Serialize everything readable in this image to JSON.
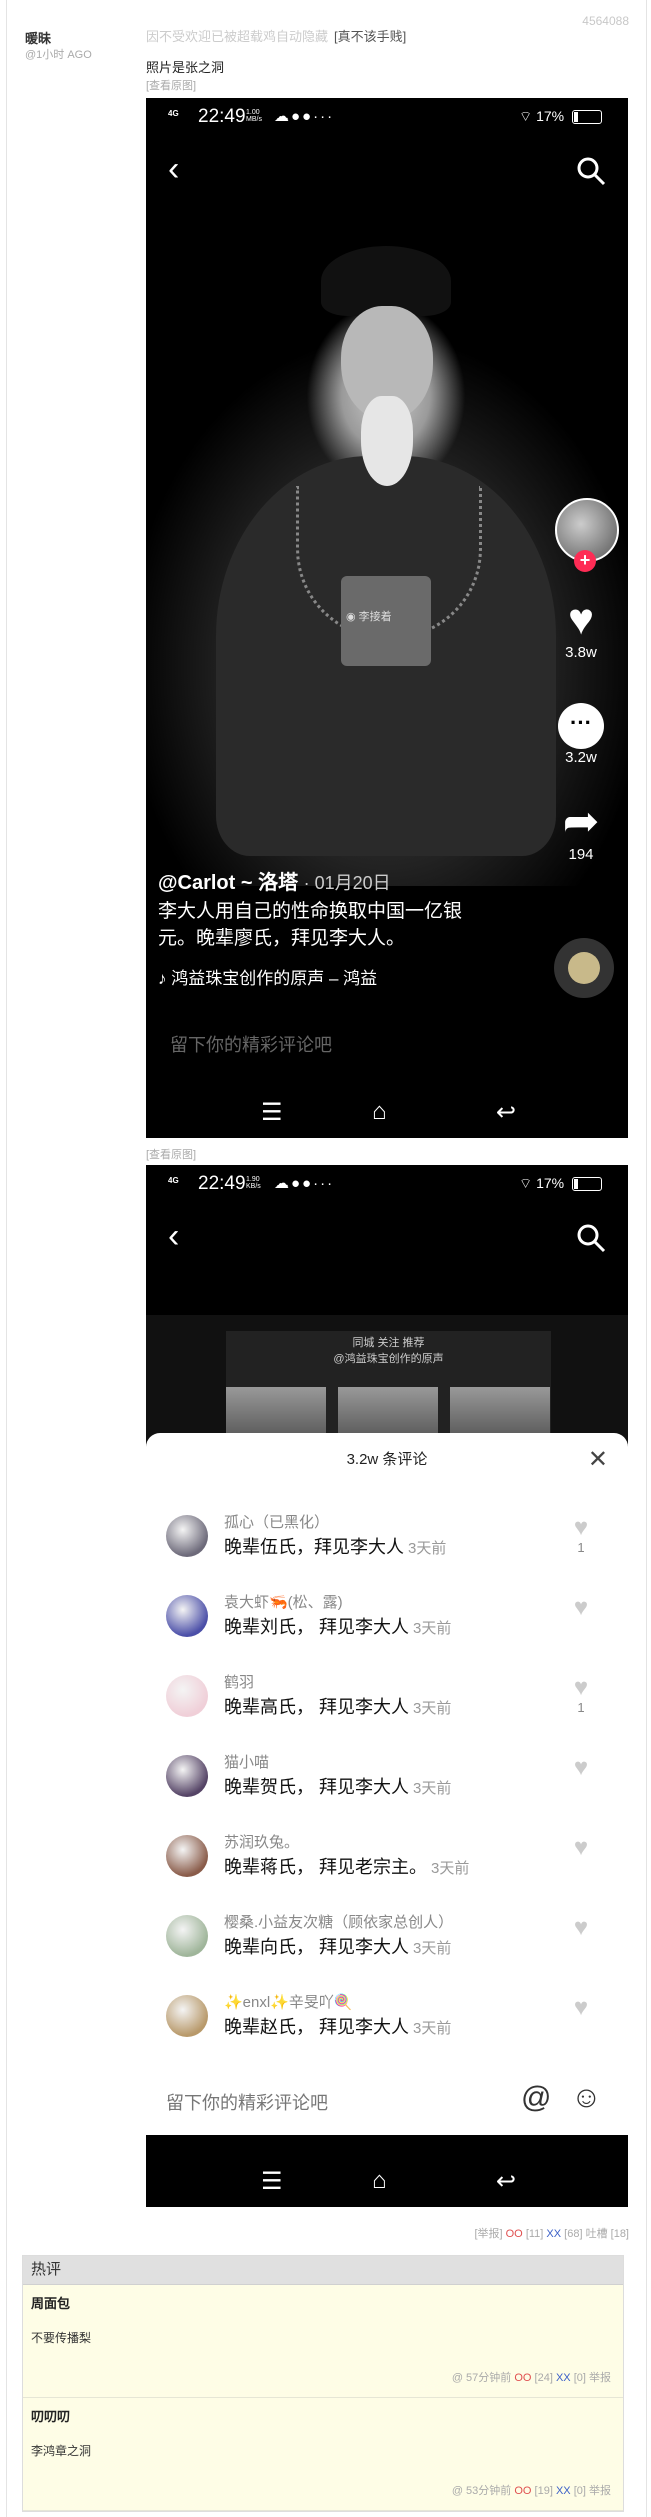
{
  "post": {
    "id": "4564088",
    "author": "暖昧",
    "time": "@1小时 AGO",
    "notice": "因不受欢迎已被超载鸡自动隐藏",
    "notice_tag": "[真不该手贱]",
    "text": "照片是张之洞",
    "view_original_1": "[查看原图]",
    "view_original_2": "[查看原图]"
  },
  "shot1": {
    "status": {
      "signal": "4G",
      "time": "22:49",
      "speed": "1.00",
      "speed_unit": "MB/s",
      "battery": "17%"
    },
    "likes": "3.8w",
    "comments": "3.2w",
    "shares": "194",
    "watermark": "李接着",
    "handle": "@Carlot ~ 洛塔",
    "date": "01月20日",
    "caption": "李大人用自己的性命换取中国一亿银元。晚辈廖氏，拜见李大人。",
    "music": "鸿益珠宝创作的原声 – 鸿益",
    "comment_placeholder": "留下你的精彩评论吧"
  },
  "shot2": {
    "status": {
      "signal": "4G",
      "time": "22:49",
      "speed": "1.90",
      "speed_unit": "KB/s",
      "battery": "17%"
    },
    "inner_tabs": "同城  关注  推荐",
    "inner_title": "@鸿益珠宝创作的原声",
    "sheet_title": "3.2w 条评论",
    "comments": [
      {
        "user": "孤心（已黑化）",
        "text": "晚辈伍氏，拜见李大人",
        "ago": "3天前",
        "likes": "1",
        "color": "#6d6a7a"
      },
      {
        "user": "袁大虾🦐(松、露)",
        "text": "晚辈刘氏，  拜见李大人",
        "ago": "3天前",
        "likes": "",
        "color": "#4b4fa8"
      },
      {
        "user": "鹤羽",
        "text": "晚辈高氏，  拜见李大人",
        "ago": "3天前",
        "likes": "1",
        "color": "#f0cfd8"
      },
      {
        "user": "猫小喵",
        "text": "晚辈贺氏，  拜见李大人",
        "ago": "3天前",
        "likes": "",
        "color": "#554466"
      },
      {
        "user": "苏润玖兔。",
        "text": "晚辈蒋氏，  拜见老宗主。",
        "ago": "3天前",
        "likes": "",
        "color": "#8a5c4a"
      },
      {
        "user": "樱桑.小益友次糖（顾依家总创人）",
        "text": "晚辈向氏，  拜见李大人",
        "ago": "3天前",
        "likes": "",
        "color": "#9fb59a"
      },
      {
        "user": "✨enxl✨辛旻吖🍭",
        "text": "晚辈赵氏，  拜见李大人",
        "ago": "3天前",
        "likes": "",
        "color": "#b8996a"
      }
    ],
    "input_placeholder": "留下你的精彩评论吧"
  },
  "footer": {
    "report": "[举报]",
    "oo": "OO",
    "oo_count": "[11]",
    "xx": "XX",
    "xx_count": "[68]",
    "tucao": "吐槽",
    "tucao_count": "[18]"
  },
  "hot": {
    "title": "热评",
    "items": [
      {
        "user": "周面包",
        "text": "不要传播梨",
        "time": "@ 57分钟前",
        "oo": "OO",
        "oo_count": "[24]",
        "xx": "XX",
        "xx_count": "[0]",
        "report": "举报"
      },
      {
        "user": "叨叨叨",
        "text": "李鸿章之洞",
        "time": "@ 53分钟前",
        "oo": "OO",
        "oo_count": "[19]",
        "xx": "XX",
        "xx_count": "[0]",
        "report": "举报"
      }
    ]
  }
}
